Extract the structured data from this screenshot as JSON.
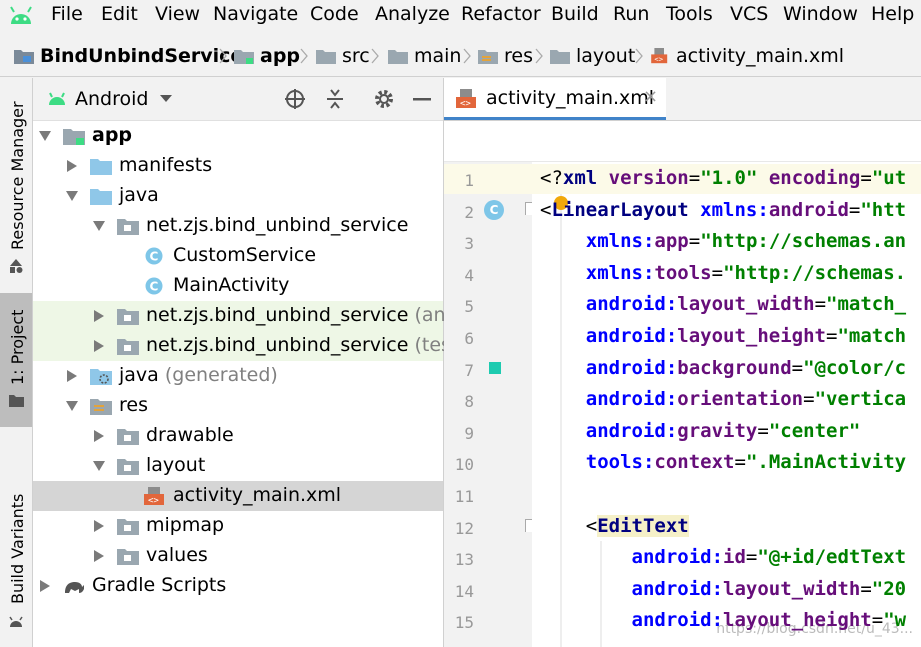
{
  "menu": [
    "File",
    "Edit",
    "View",
    "Navigate",
    "Code",
    "Analyze",
    "Refactor",
    "Build",
    "Run",
    "Tools",
    "VCS",
    "Window",
    "Help"
  ],
  "breadcrumb": [
    "BindUnbindService",
    "app",
    "src",
    "main",
    "res",
    "layout",
    "activity_main.xml"
  ],
  "side_tabs": {
    "resource_manager": "Resource Manager",
    "project": "1: Project",
    "build_variants": "Build Variants"
  },
  "project": {
    "view_mode": "Android",
    "tree": [
      {
        "label": "app",
        "bold": true,
        "icon": "module-folder-icon"
      },
      {
        "label": "manifests",
        "icon": "folder-icon"
      },
      {
        "label": "java",
        "icon": "folder-icon"
      },
      {
        "label": "net.zjs.bind_unbind_service",
        "icon": "package-icon"
      },
      {
        "label": "CustomService",
        "icon": "class-icon"
      },
      {
        "label": "MainActivity",
        "icon": "class-icon"
      },
      {
        "label": "net.zjs.bind_unbind_service",
        "suffix": "(andro",
        "icon": "package-icon"
      },
      {
        "label": "net.zjs.bind_unbind_service",
        "suffix": "(test)",
        "icon": "package-icon"
      },
      {
        "label": "java",
        "suffix": "(generated)",
        "icon": "generated-folder-icon"
      },
      {
        "label": "res",
        "icon": "resource-folder-icon"
      },
      {
        "label": "drawable",
        "icon": "package-icon"
      },
      {
        "label": "layout",
        "icon": "package-icon"
      },
      {
        "label": "activity_main.xml",
        "icon": "xml-file-icon"
      },
      {
        "label": "mipmap",
        "icon": "package-icon"
      },
      {
        "label": "values",
        "icon": "package-icon"
      },
      {
        "label": "Gradle Scripts",
        "icon": "gradle-icon"
      }
    ]
  },
  "editor": {
    "tab_label": "activity_main.xml",
    "line_numbers": [
      "1",
      "2",
      "3",
      "4",
      "5",
      "6",
      "7",
      "8",
      "9",
      "10",
      "11",
      "12",
      "13",
      "14",
      "15"
    ],
    "lines": [
      [
        [
          "pun",
          "<?"
        ],
        [
          "tag",
          "xml "
        ],
        [
          "attr",
          "version"
        ],
        [
          "pun",
          "="
        ],
        [
          "str",
          "\"1.0\""
        ],
        [
          "plain",
          " "
        ],
        [
          "attr",
          "encoding"
        ],
        [
          "pun",
          "="
        ],
        [
          "str",
          "\"ut"
        ]
      ],
      [
        [
          "pun",
          "<"
        ],
        [
          "tag",
          "LinearLayout "
        ],
        [
          "ns",
          "xmlns:"
        ],
        [
          "attr",
          "android"
        ],
        [
          "pun",
          "="
        ],
        [
          "str",
          "\"htt"
        ]
      ],
      [
        [
          "plain",
          "    "
        ],
        [
          "ns",
          "xmlns:"
        ],
        [
          "attr",
          "app"
        ],
        [
          "pun",
          "="
        ],
        [
          "str",
          "\"http://schemas.an"
        ]
      ],
      [
        [
          "plain",
          "    "
        ],
        [
          "ns",
          "xmlns:"
        ],
        [
          "attr",
          "tools"
        ],
        [
          "pun",
          "="
        ],
        [
          "str",
          "\"http://schemas."
        ]
      ],
      [
        [
          "plain",
          "    "
        ],
        [
          "ns",
          "android:"
        ],
        [
          "attr",
          "layout_width"
        ],
        [
          "pun",
          "="
        ],
        [
          "str",
          "\"match_"
        ]
      ],
      [
        [
          "plain",
          "    "
        ],
        [
          "ns",
          "android:"
        ],
        [
          "attr",
          "layout_height"
        ],
        [
          "pun",
          "="
        ],
        [
          "str",
          "\"match"
        ]
      ],
      [
        [
          "plain",
          "    "
        ],
        [
          "ns",
          "android:"
        ],
        [
          "attr",
          "background"
        ],
        [
          "pun",
          "="
        ],
        [
          "str",
          "\"@color/c"
        ]
      ],
      [
        [
          "plain",
          "    "
        ],
        [
          "ns",
          "android:"
        ],
        [
          "attr",
          "orientation"
        ],
        [
          "pun",
          "="
        ],
        [
          "str",
          "\"vertica"
        ]
      ],
      [
        [
          "plain",
          "    "
        ],
        [
          "ns",
          "android:"
        ],
        [
          "attr",
          "gravity"
        ],
        [
          "pun",
          "="
        ],
        [
          "str",
          "\"center\""
        ]
      ],
      [
        [
          "plain",
          "    "
        ],
        [
          "ns",
          "tools:"
        ],
        [
          "attr",
          "context"
        ],
        [
          "pun",
          "="
        ],
        [
          "str",
          "\".MainActivity"
        ]
      ],
      [
        [
          "plain",
          ""
        ]
      ],
      [
        [
          "plain",
          "    "
        ],
        [
          "pun",
          "<"
        ],
        [
          "tag",
          "EditText"
        ]
      ],
      [
        [
          "plain",
          "        "
        ],
        [
          "ns",
          "android:"
        ],
        [
          "attr",
          "id"
        ],
        [
          "pun",
          "="
        ],
        [
          "str",
          "\"@+id/edtText"
        ]
      ],
      [
        [
          "plain",
          "        "
        ],
        [
          "ns",
          "android:"
        ],
        [
          "attr",
          "layout_width"
        ],
        [
          "pun",
          "="
        ],
        [
          "str",
          "\"20"
        ]
      ],
      [
        [
          "plain",
          "        "
        ],
        [
          "ns",
          "android:"
        ],
        [
          "attr",
          "layout_height"
        ],
        [
          "pun",
          "="
        ],
        [
          "str",
          "\"w"
        ]
      ]
    ]
  },
  "watermark": "https://blog.csdn.net/u_43..."
}
